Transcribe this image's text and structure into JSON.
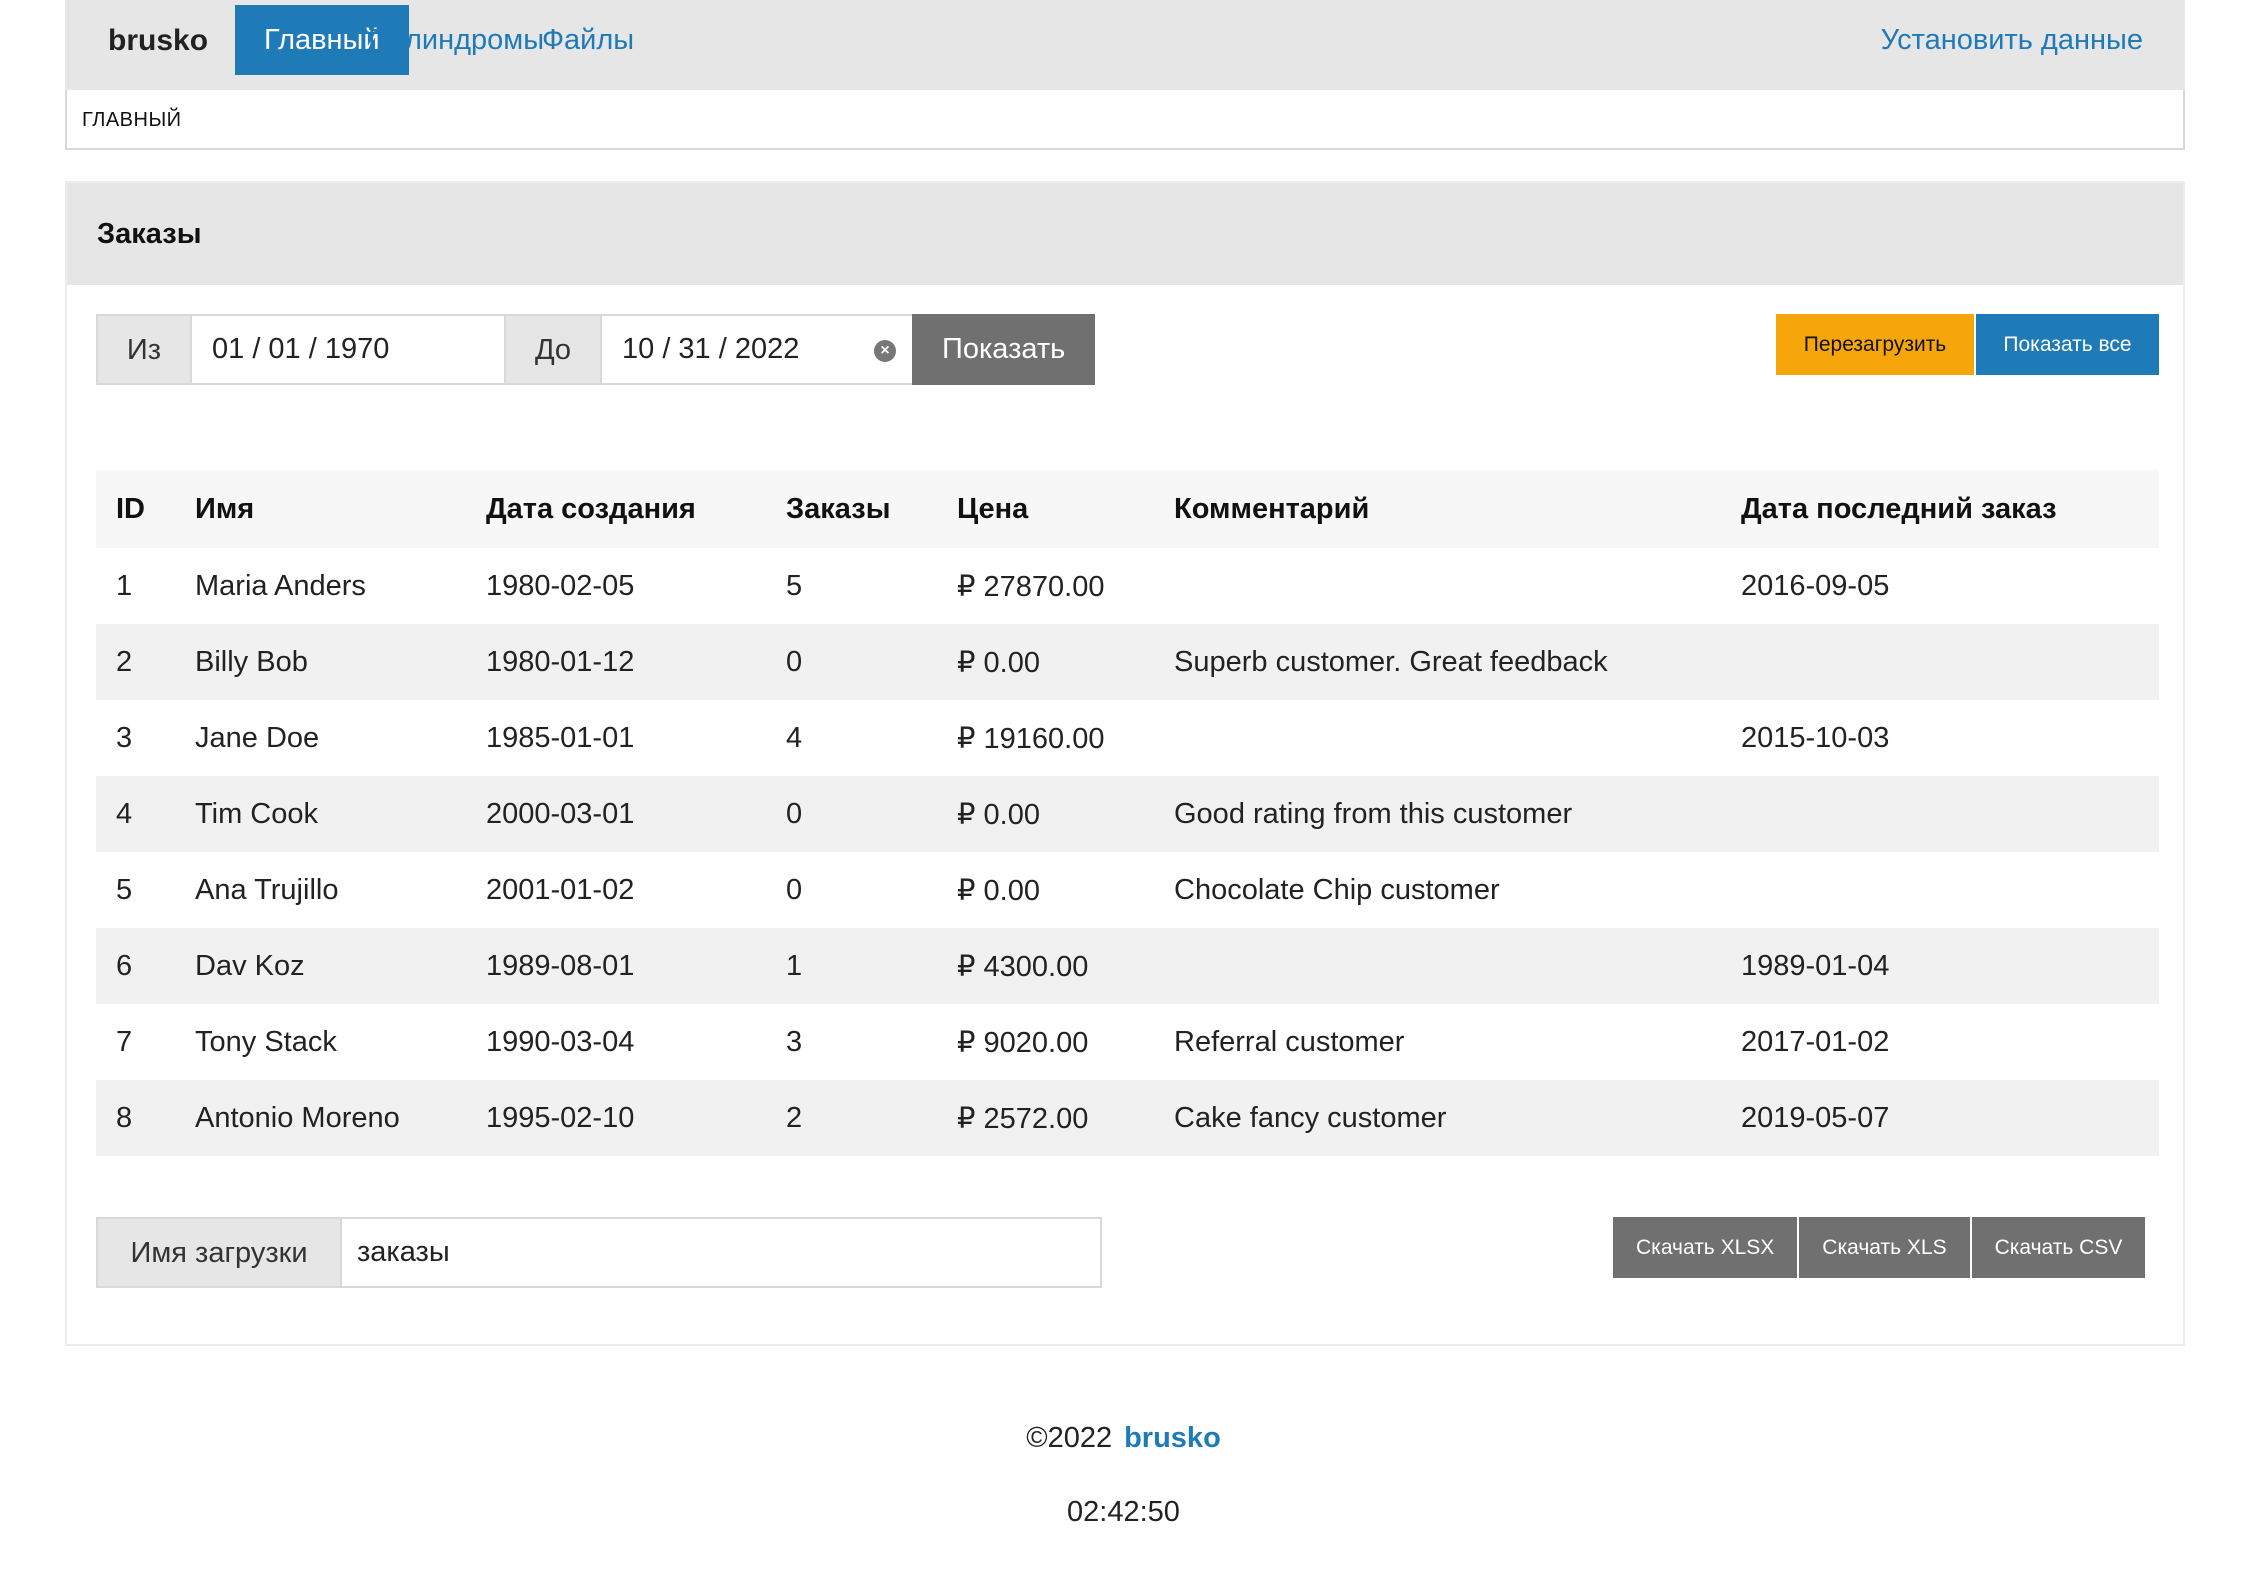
{
  "navbar": {
    "brand": "brusko",
    "links": [
      {
        "label": "Главный"
      },
      {
        "label": "Палиндромы"
      },
      {
        "label": "Файлы"
      }
    ],
    "right_link": "Установить данные"
  },
  "breadcrumb": "ГЛАВНЫЙ",
  "panel": {
    "title": "Заказы",
    "filter": {
      "from_label": "Из",
      "from_value": "01 / 01 / 1970",
      "to_label": "До",
      "to_value": "10 / 31 / 2022",
      "show_button": "Показать"
    },
    "reload_button": "Перезагрузить",
    "show_all_button": "Показать все"
  },
  "table": {
    "columns": [
      "ID",
      "Имя",
      "Дата создания",
      "Заказы",
      "Цена",
      "Комментарий",
      "Дата последний заказ"
    ],
    "rows": [
      [
        "1",
        "Maria Anders",
        "1980-02-05",
        "5",
        "₽ 27870.00",
        "",
        "2016-09-05"
      ],
      [
        "2",
        "Billy Bob",
        "1980-01-12",
        "0",
        "₽ 0.00",
        "Superb customer. Great feedback",
        ""
      ],
      [
        "3",
        "Jane Doe",
        "1985-01-01",
        "4",
        "₽ 19160.00",
        "",
        "2015-10-03"
      ],
      [
        "4",
        "Tim Cook",
        "2000-03-01",
        "0",
        "₽ 0.00",
        "Good rating from this customer",
        ""
      ],
      [
        "5",
        "Ana Trujillo",
        "2001-01-02",
        "0",
        "₽ 0.00",
        "Chocolate Chip customer",
        ""
      ],
      [
        "6",
        "Dav Koz",
        "1989-08-01",
        "1",
        "₽ 4300.00",
        "",
        "1989-01-04"
      ],
      [
        "7",
        "Tony Stack",
        "1990-03-04",
        "3",
        "₽ 9020.00",
        "Referral customer",
        "2017-01-02"
      ],
      [
        "8",
        "Antonio Moreno",
        "1995-02-10",
        "2",
        "₽ 2572.00",
        "Cake fancy customer",
        "2019-05-07"
      ]
    ]
  },
  "download": {
    "label": "Имя загрузки",
    "value": "заказы",
    "buttons": [
      "Скачать XLSX",
      "Скачать XLS",
      "Скачать CSV"
    ]
  },
  "footer": {
    "copyright": "©2022",
    "brand": "brusko",
    "clock": "02:42:50"
  },
  "colors": {
    "primary": "#1f7ab8",
    "warning": "#f6a60a",
    "secondary": "#707070",
    "navbar_bg": "#e6e6e6"
  }
}
